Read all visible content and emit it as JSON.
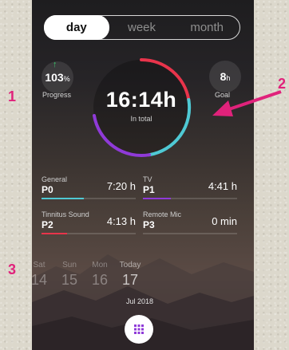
{
  "period_tabs": [
    {
      "label": "day",
      "active": true
    },
    {
      "label": "week",
      "active": false
    },
    {
      "label": "month",
      "active": false
    }
  ],
  "progress": {
    "value": "103",
    "unit": "%",
    "label": "Progress"
  },
  "goal": {
    "value": "8",
    "unit": "h",
    "label": "Goal"
  },
  "total": {
    "value": "16:14h",
    "label": "In total"
  },
  "ring_colors": {
    "red": "#e8344b",
    "cyan": "#4fc9d4",
    "purple": "#8f3ad8"
  },
  "programs": [
    {
      "name": "General",
      "code": "P0",
      "time": "7:20 h",
      "color": "#4fc9d4",
      "fill": 0.45
    },
    {
      "name": "TV",
      "code": "P1",
      "time": "4:41 h",
      "color": "#8f3ad8",
      "fill": 0.3
    },
    {
      "name": "Tinnitus Sound",
      "code": "P2",
      "time": "4:13 h",
      "color": "#e8344b",
      "fill": 0.27
    },
    {
      "name": "Remote Mic",
      "code": "P3",
      "time": "0 min",
      "color": "#8f3ad8",
      "fill": 0.0
    }
  ],
  "days": [
    {
      "name": "Sat",
      "num": "14"
    },
    {
      "name": "Sun",
      "num": "15"
    },
    {
      "name": "Mon",
      "num": "16"
    },
    {
      "name": "Today",
      "num": "17"
    }
  ],
  "month": "Jul 2018",
  "annotations": {
    "one": "1",
    "two": "2",
    "three": "3",
    "color": "#e0227b"
  }
}
